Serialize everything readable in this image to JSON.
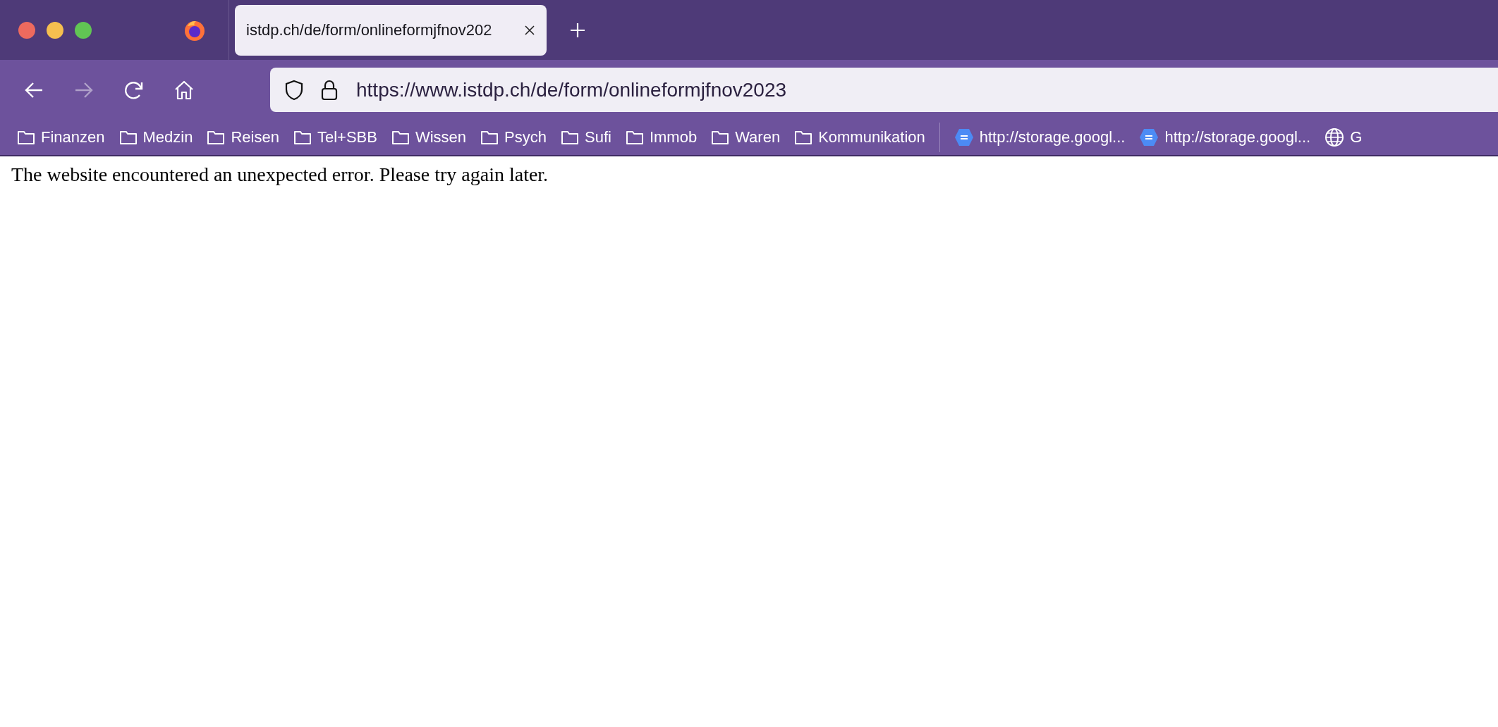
{
  "tabs": [
    {
      "title": "istdp.ch/de/form/onlineformjfnov202",
      "selected": true
    }
  ],
  "toolbar": {
    "back_disabled": false,
    "forward_disabled": true
  },
  "address_bar": {
    "url": "https://www.istdp.ch/de/form/onlineformjfnov2023"
  },
  "bookmarks": [
    {
      "kind": "folder",
      "label": "Finanzen"
    },
    {
      "kind": "folder",
      "label": "Medzin"
    },
    {
      "kind": "folder",
      "label": "Reisen"
    },
    {
      "kind": "folder",
      "label": "Tel+SBB"
    },
    {
      "kind": "folder",
      "label": "Wissen"
    },
    {
      "kind": "folder",
      "label": "Psych"
    },
    {
      "kind": "folder",
      "label": "Sufi"
    },
    {
      "kind": "folder",
      "label": "Immob"
    },
    {
      "kind": "folder",
      "label": "Waren"
    },
    {
      "kind": "folder",
      "label": "Kommunikation"
    },
    {
      "kind": "separator"
    },
    {
      "kind": "doc",
      "label": "http://storage.googl..."
    },
    {
      "kind": "doc",
      "label": "http://storage.googl..."
    },
    {
      "kind": "web",
      "label": "G"
    }
  ],
  "page": {
    "message": "The website encountered an unexpected error. Please try again later."
  }
}
